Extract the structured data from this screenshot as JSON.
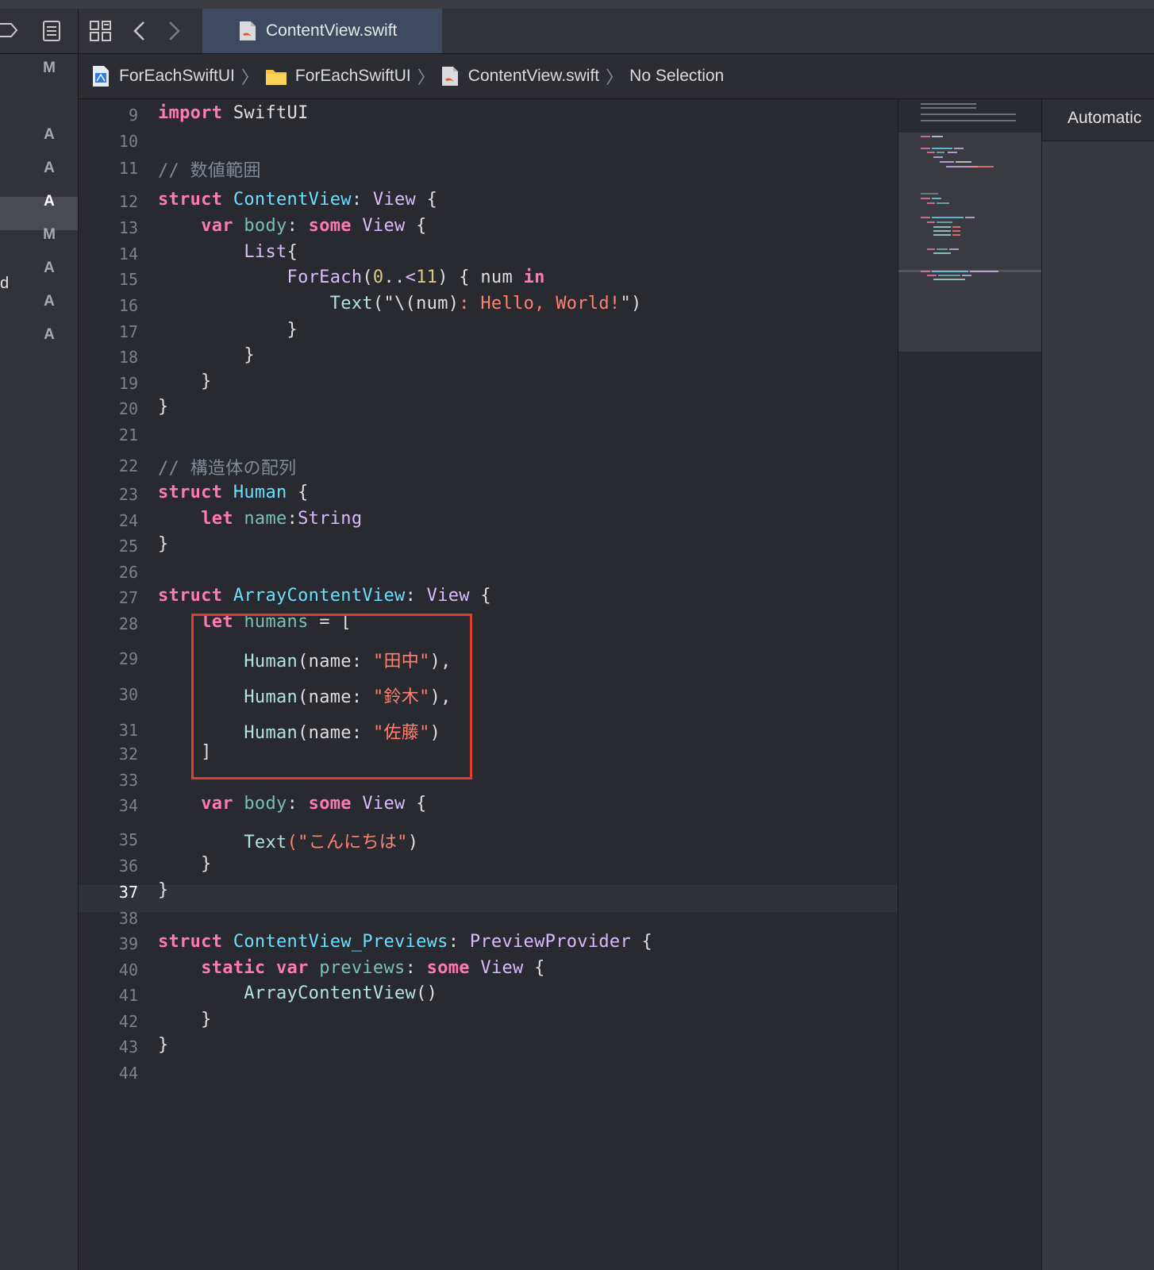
{
  "navigator": {
    "status_letters": [
      "M",
      "A",
      "A",
      "A",
      "M",
      "A",
      "A",
      "A"
    ],
    "cut_text": "d"
  },
  "tabs": [
    {
      "label": "ContentView.swift",
      "icon": "swift-file-icon"
    }
  ],
  "breadcrumb": [
    {
      "label": "ForEachSwiftUI",
      "icon": "xcode-project-icon"
    },
    {
      "label": "ForEachSwiftUI",
      "icon": "folder-icon"
    },
    {
      "label": "ContentView.swift",
      "icon": "swift-file-icon"
    },
    {
      "label": "No Selection",
      "icon": ""
    }
  ],
  "editor": {
    "current_line": "37",
    "lines": [
      {
        "n": "9"
      },
      {
        "n": "10"
      },
      {
        "n": "11"
      },
      {
        "n": "12"
      },
      {
        "n": "13"
      },
      {
        "n": "14"
      },
      {
        "n": "15"
      },
      {
        "n": "16"
      },
      {
        "n": "17"
      },
      {
        "n": "18"
      },
      {
        "n": "19"
      },
      {
        "n": "20"
      },
      {
        "n": "21"
      },
      {
        "n": "22"
      },
      {
        "n": "23"
      },
      {
        "n": "24"
      },
      {
        "n": "25"
      },
      {
        "n": "26"
      },
      {
        "n": "27"
      },
      {
        "n": "28"
      },
      {
        "n": "29"
      },
      {
        "n": "30"
      },
      {
        "n": "31"
      },
      {
        "n": "32"
      },
      {
        "n": "33"
      },
      {
        "n": "34"
      },
      {
        "n": "35"
      },
      {
        "n": "36"
      },
      {
        "n": "37"
      },
      {
        "n": "38"
      },
      {
        "n": "39"
      },
      {
        "n": "40"
      },
      {
        "n": "41"
      },
      {
        "n": "42"
      },
      {
        "n": "43"
      },
      {
        "n": "44"
      }
    ],
    "code": {
      "l9": [
        [
          "kw",
          "import"
        ],
        [
          "plain",
          " SwiftUI"
        ]
      ],
      "l11": [
        [
          "cmt",
          "// 数値範囲"
        ]
      ],
      "l12": [
        [
          "kw",
          "struct"
        ],
        [
          "plain",
          " "
        ],
        [
          "decl",
          "ContentView"
        ],
        [
          "plain",
          ": "
        ],
        [
          "type",
          "View"
        ],
        [
          "plain",
          " {"
        ]
      ],
      "l13": [
        [
          "plain",
          "    "
        ],
        [
          "kw",
          "var"
        ],
        [
          "plain",
          " "
        ],
        [
          "prop",
          "body"
        ],
        [
          "plain",
          ": "
        ],
        [
          "kw",
          "some"
        ],
        [
          "plain",
          " "
        ],
        [
          "type",
          "View"
        ],
        [
          "plain",
          " {"
        ]
      ],
      "l14": [
        [
          "plain",
          "        "
        ],
        [
          "type",
          "List"
        ],
        [
          "plain",
          "{"
        ]
      ],
      "l15": [
        [
          "plain",
          "            "
        ],
        [
          "type",
          "ForEach"
        ],
        [
          "plain",
          "("
        ],
        [
          "num",
          "0"
        ],
        [
          "plain",
          ".."
        ],
        [
          "type",
          "<"
        ],
        [
          "num",
          "11"
        ],
        [
          "plain",
          ") { num "
        ],
        [
          "kw",
          "in"
        ]
      ],
      "l16": [
        [
          "plain",
          "                "
        ],
        [
          "fn",
          "Text"
        ],
        [
          "plain",
          "(\"\\(num)"
        ],
        [
          "str",
          ": Hello, World!"
        ],
        [
          "plain",
          "\")"
        ]
      ],
      "l17": [
        [
          "plain",
          "            }"
        ]
      ],
      "l18": [
        [
          "plain",
          "        }"
        ]
      ],
      "l19": [
        [
          "plain",
          "    }"
        ]
      ],
      "l20": [
        [
          "plain",
          "}"
        ]
      ],
      "l22": [
        [
          "cmt",
          "// 構造体の配列"
        ]
      ],
      "l23": [
        [
          "kw",
          "struct"
        ],
        [
          "plain",
          " "
        ],
        [
          "decl",
          "Human"
        ],
        [
          "plain",
          " {"
        ]
      ],
      "l24": [
        [
          "plain",
          "    "
        ],
        [
          "kw",
          "let"
        ],
        [
          "plain",
          " "
        ],
        [
          "prop",
          "name"
        ],
        [
          "plain",
          ":"
        ],
        [
          "type",
          "String"
        ]
      ],
      "l25": [
        [
          "plain",
          "}"
        ]
      ],
      "l27": [
        [
          "kw",
          "struct"
        ],
        [
          "plain",
          " "
        ],
        [
          "decl",
          "ArrayContentView"
        ],
        [
          "plain",
          ": "
        ],
        [
          "type",
          "View"
        ],
        [
          "plain",
          " {"
        ]
      ],
      "l28": [
        [
          "plain",
          "    "
        ],
        [
          "kw",
          "let"
        ],
        [
          "plain",
          " "
        ],
        [
          "prop",
          "humans"
        ],
        [
          "plain",
          " = ["
        ]
      ],
      "l29": [
        [
          "plain",
          "        "
        ],
        [
          "fn",
          "Human"
        ],
        [
          "plain",
          "(name: "
        ],
        [
          "str",
          "\"田中\""
        ],
        [
          "plain",
          "),"
        ]
      ],
      "l30": [
        [
          "plain",
          "        "
        ],
        [
          "fn",
          "Human"
        ],
        [
          "plain",
          "(name: "
        ],
        [
          "str",
          "\"鈴木\""
        ],
        [
          "plain",
          "),"
        ]
      ],
      "l31": [
        [
          "plain",
          "        "
        ],
        [
          "fn",
          "Human"
        ],
        [
          "plain",
          "(name: "
        ],
        [
          "str",
          "\"佐藤\""
        ],
        [
          "plain",
          ")"
        ]
      ],
      "l32": [
        [
          "plain",
          "    ]"
        ]
      ],
      "l34": [
        [
          "plain",
          "    "
        ],
        [
          "kw",
          "var"
        ],
        [
          "plain",
          " "
        ],
        [
          "prop",
          "body"
        ],
        [
          "plain",
          ": "
        ],
        [
          "kw",
          "some"
        ],
        [
          "plain",
          " "
        ],
        [
          "type",
          "View"
        ],
        [
          "plain",
          " {"
        ]
      ],
      "l35": [
        [
          "plain",
          "        "
        ],
        [
          "fn",
          "Text"
        ],
        [
          "str",
          "(\"こんにちは\""
        ],
        [
          "plain",
          ")"
        ]
      ],
      "l36": [
        [
          "plain",
          "    }"
        ]
      ],
      "l37": [
        [
          "plain",
          "}"
        ]
      ],
      "l39": [
        [
          "kw",
          "struct"
        ],
        [
          "plain",
          " "
        ],
        [
          "decl",
          "ContentView_Previews"
        ],
        [
          "plain",
          ": "
        ],
        [
          "type",
          "PreviewProvider"
        ],
        [
          "plain",
          " {"
        ]
      ],
      "l40": [
        [
          "plain",
          "    "
        ],
        [
          "kw",
          "static"
        ],
        [
          "plain",
          " "
        ],
        [
          "kw",
          "var"
        ],
        [
          "plain",
          " "
        ],
        [
          "prop",
          "previews"
        ],
        [
          "plain",
          ": "
        ],
        [
          "kw",
          "some"
        ],
        [
          "plain",
          " "
        ],
        [
          "type",
          "View"
        ],
        [
          "plain",
          " {"
        ]
      ],
      "l41": [
        [
          "plain",
          "        "
        ],
        [
          "fn",
          "ArrayContentView"
        ],
        [
          "plain",
          "()"
        ]
      ],
      "l42": [
        [
          "plain",
          "    }"
        ]
      ],
      "l43": [
        [
          "plain",
          "}"
        ]
      ]
    }
  },
  "inspector": {
    "header": "Automatic"
  },
  "colors": {
    "keyword": "#ff7ab2",
    "type": "#dabaff",
    "declaration": "#6bdfff",
    "string": "#ff8170",
    "number": "#d9c97c",
    "comment": "#7f8c98",
    "highlight_box": "#e0402a"
  }
}
